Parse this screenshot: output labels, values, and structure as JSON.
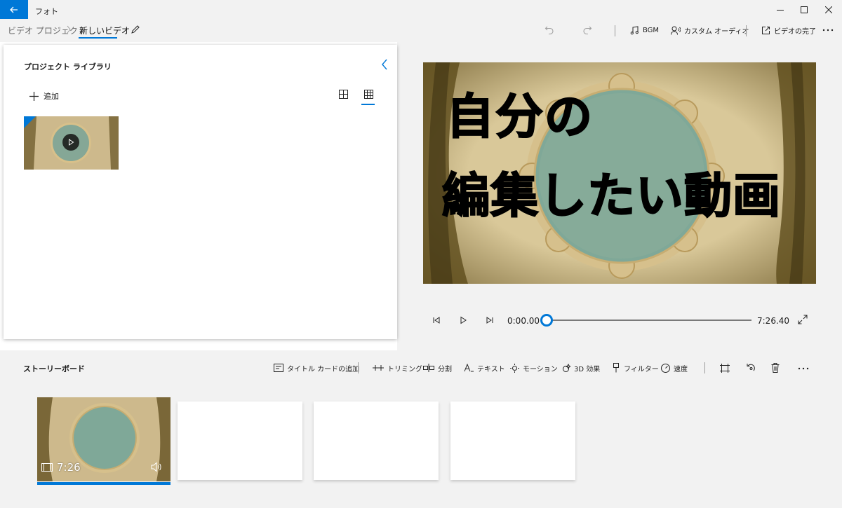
{
  "window": {
    "app_title": "フォト"
  },
  "breadcrumb": {
    "items": [
      "ビデオ プロジェクト",
      "新しいビデオ"
    ]
  },
  "toolbar": {
    "bgm": "BGM",
    "custom_audio": "カスタム オーディオ",
    "finish_video": "ビデオの完了"
  },
  "library": {
    "title": "プロジェクト ライブラリ",
    "add_label": "追加",
    "selected_view": "small-grid"
  },
  "preview": {
    "overlay_line1": "自分の",
    "overlay_line2": "編集したい動画",
    "current_time": "0:00.00",
    "total_time": "7:26.40",
    "progress": 0
  },
  "storyboard": {
    "title": "ストーリーボード",
    "tools": {
      "add_title_card": "タイトル カードの追加",
      "trim": "トリミング",
      "split": "分割",
      "text": "テキスト",
      "motion": "モーション",
      "effects_3d": "3D 効果",
      "filters": "フィルター",
      "speed": "速度"
    },
    "clips": [
      {
        "duration": "7:26",
        "selected": true
      }
    ],
    "empty_slots": 3
  },
  "colors": {
    "accent": "#0078d7",
    "chrome": "#f2f2f2",
    "parchment": "#c9b68a",
    "medallion": "#7fa898"
  }
}
